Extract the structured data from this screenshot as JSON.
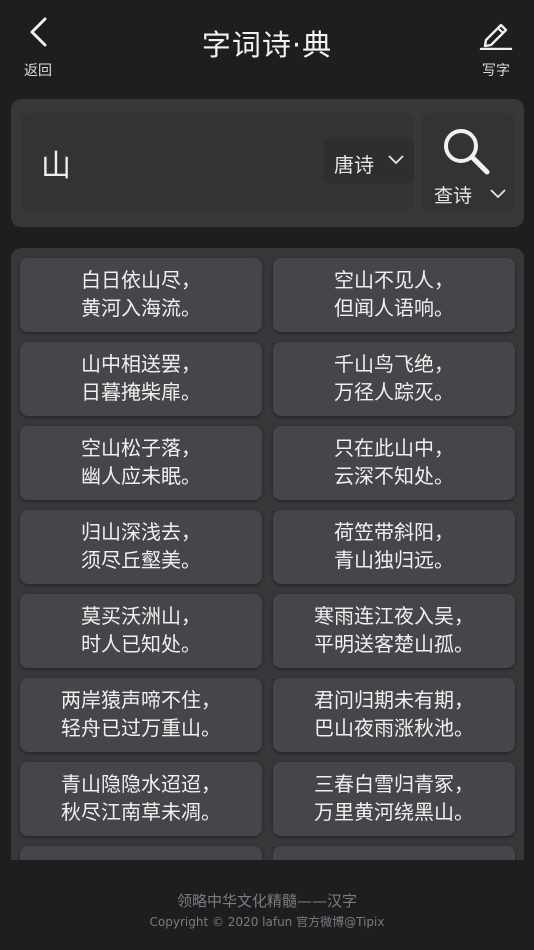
{
  "header": {
    "back_label": "返回",
    "title": "字词诗·典",
    "write_label": "写字"
  },
  "search": {
    "query": "山",
    "category": "唐诗",
    "button_label": "查诗"
  },
  "results": [
    {
      "line1": "白日依山尽，",
      "line2": "黄河入海流。"
    },
    {
      "line1": "空山不见人，",
      "line2": "但闻人语响。"
    },
    {
      "line1": "山中相送罢，",
      "line2": "日暮掩柴扉。"
    },
    {
      "line1": "千山鸟飞绝，",
      "line2": "万径人踪灭。"
    },
    {
      "line1": "空山松子落，",
      "line2": "幽人应未眠。"
    },
    {
      "line1": "只在此山中，",
      "line2": "云深不知处。"
    },
    {
      "line1": "归山深浅去，",
      "line2": "须尽丘壑美。"
    },
    {
      "line1": "荷笠带斜阳，",
      "line2": "青山独归远。"
    },
    {
      "line1": "莫买沃洲山，",
      "line2": "时人已知处。"
    },
    {
      "line1": "寒雨连江夜入吴，",
      "line2": "平明送客楚山孤。"
    },
    {
      "line1": "两岸猿声啼不住，",
      "line2": "轻舟已过万重山。"
    },
    {
      "line1": "君问归期未有期，",
      "line2": "巴山夜雨涨秋池。"
    },
    {
      "line1": "青山隐隐水迢迢，",
      "line2": "秋尽江南草未凋。"
    },
    {
      "line1": "三春白雪归青冢，",
      "line2": "万里黄河绕黑山。"
    }
  ],
  "footer": {
    "slogan": "领略中华文化精髓——汉字",
    "copyright": "Copyright © 2020  lafun 官方微博@Tipix"
  }
}
